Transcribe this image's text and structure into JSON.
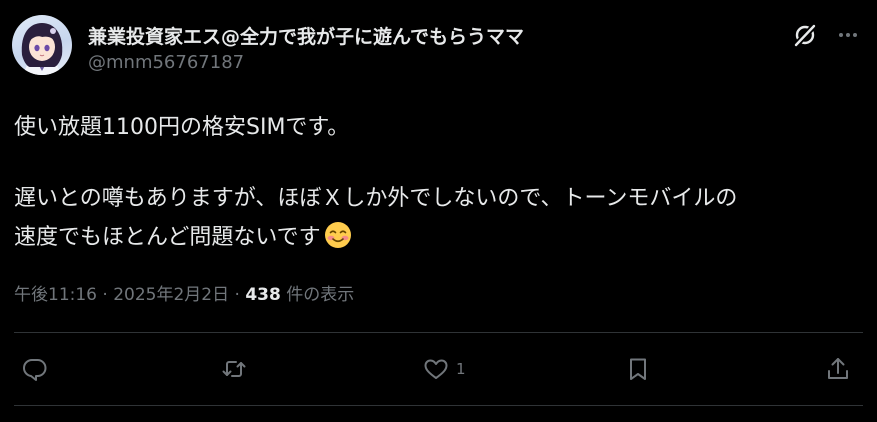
{
  "author": {
    "display_name": "兼業投資家エス@全力で我が子に遊んでもらうママ",
    "handle": "@mnm56767187",
    "avatar_icon": "anime-avatar-icon"
  },
  "header_icons": [
    "grok-icon",
    "more-icon"
  ],
  "tweet": {
    "line1": "使い放題1100円の格安SIMです。",
    "line2": "遅いとの噂もありますが、ほぼＸしか外でしないので、トーンモバイルの",
    "line3": "速度でもほとんど問題ないです",
    "emoji": "smiling-face-icon"
  },
  "meta": {
    "time": "午後11:16",
    "separator": " · ",
    "date": "2025年2月2日",
    "separator2": " · ",
    "views_count": "438",
    "views_label": " 件の表示"
  },
  "actions": {
    "reply_count": "",
    "retweet_count": "",
    "like_count": "1",
    "bookmark_count": ""
  },
  "colors": {
    "background": "#000000",
    "text": "#e7e9ea",
    "secondary_text": "#71767b",
    "divider": "#2f3336"
  }
}
